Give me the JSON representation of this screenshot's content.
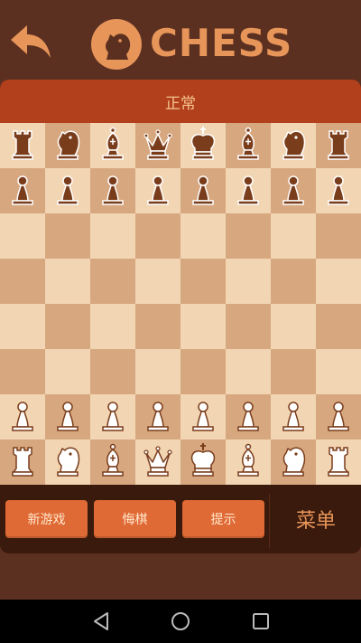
{
  "header": {
    "title": "CHESS",
    "back_icon": "back-arrow-icon",
    "logo_icon": "knight-logo-icon"
  },
  "status": {
    "text": "正常"
  },
  "board": {
    "rows": [
      [
        "br",
        "bn",
        "bb",
        "bq",
        "bk",
        "bb",
        "bn",
        "br"
      ],
      [
        "bp",
        "bp",
        "bp",
        "bp",
        "bp",
        "bp",
        "bp",
        "bp"
      ],
      [
        "",
        "",
        "",
        "",
        "",
        "",
        "",
        ""
      ],
      [
        "",
        "",
        "",
        "",
        "",
        "",
        "",
        ""
      ],
      [
        "",
        "",
        "",
        "",
        "",
        "",
        "",
        ""
      ],
      [
        "",
        "",
        "",
        "",
        "",
        "",
        "",
        ""
      ],
      [
        "wp",
        "wp",
        "wp",
        "wp",
        "wp",
        "wp",
        "wp",
        "wp"
      ],
      [
        "wr",
        "wn",
        "wb",
        "wq",
        "wk",
        "wb",
        "wn",
        "wr"
      ]
    ],
    "colors": {
      "light": "#f2d5b3",
      "dark": "#d7a880",
      "white_piece": "#ffffff",
      "black_piece": "#7a3d1c"
    }
  },
  "controls": {
    "new_game": "新游戏",
    "undo": "悔棋",
    "hint": "提示",
    "menu": "菜单"
  },
  "nav": {
    "back_icon": "triangle-back-icon",
    "home_icon": "circle-home-icon",
    "recents_icon": "square-recents-icon"
  }
}
